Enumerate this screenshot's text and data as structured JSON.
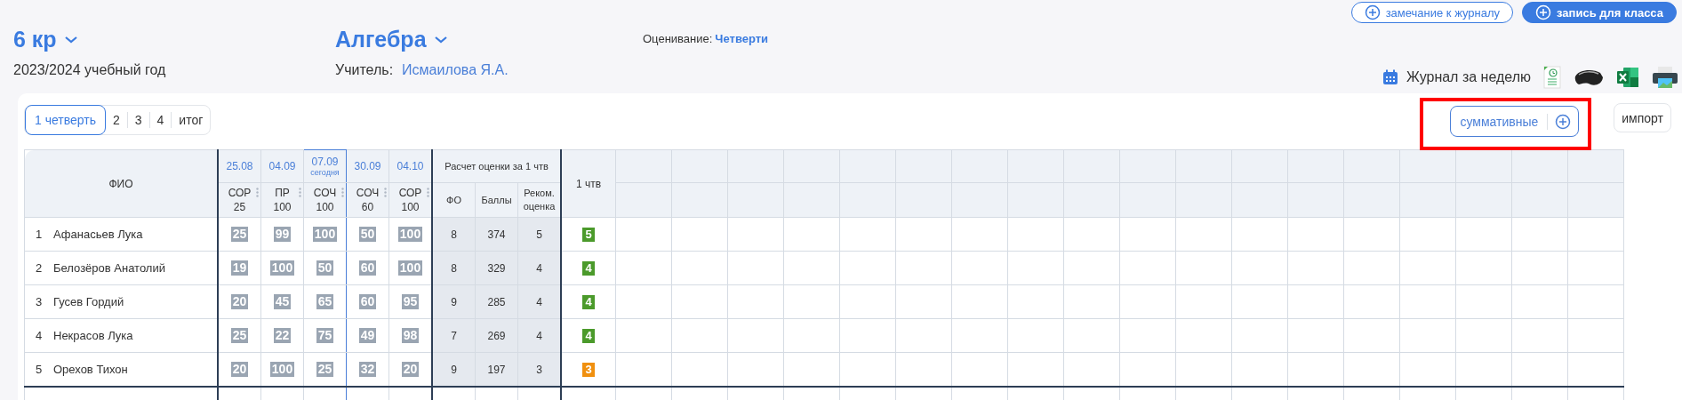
{
  "header_buttons": [
    {
      "label": "замечание к журналу",
      "kind": "outline"
    },
    {
      "label": "запись для класса",
      "kind": "filled"
    }
  ],
  "class_selector": {
    "label": "6 кр"
  },
  "school_year": "2023/2024 учебный год",
  "subject_selector": {
    "label": "Алгебра"
  },
  "teacher": {
    "label": "Учитель:",
    "value": "Исмаилова Я.А."
  },
  "grading": {
    "label": "Оценивание:",
    "value": "Четверти"
  },
  "toolbar": {
    "weekly_journal": "Журнал за неделю"
  },
  "period_tabs": [
    {
      "label": "1 четверть",
      "selected": true
    },
    {
      "label": "2",
      "selected": false
    },
    {
      "label": "3",
      "selected": false
    },
    {
      "label": "4",
      "selected": false
    },
    {
      "label": "итог",
      "selected": false
    }
  ],
  "summative_button": {
    "label": "суммативные",
    "highlighted": true
  },
  "import_button": {
    "label": "импорт"
  },
  "table": {
    "name_header": "ФИО",
    "assessments": [
      {
        "date": "25.08",
        "type": "СОР",
        "max": "25",
        "today": false
      },
      {
        "date": "04.09",
        "type": "ПР",
        "max": "100",
        "today": false
      },
      {
        "date": "07.09",
        "today_label": "сегодня",
        "type": "СОЧ",
        "max": "100",
        "today": true
      },
      {
        "date": "30.09",
        "type": "СОЧ",
        "max": "60",
        "today": false
      },
      {
        "date": "04.10",
        "type": "СОР",
        "max": "100",
        "today": false
      }
    ],
    "calc_header": "Расчет оценки за 1 чтв",
    "calc_columns": [
      "ФО",
      "Баллы",
      "Реком. оценка"
    ],
    "final_header": "1 чтв",
    "rows": [
      {
        "number": "1",
        "name": "Афанасьев Лука",
        "scores": [
          "25",
          "99",
          "100",
          "50",
          "100"
        ],
        "fo": "8",
        "points": "374",
        "recommended": "5",
        "final": {
          "value": "5",
          "color": "#4b9a2b"
        }
      },
      {
        "number": "2",
        "name": "Белозёров Анатолий",
        "scores": [
          "19",
          "100",
          "50",
          "60",
          "100"
        ],
        "fo": "8",
        "points": "329",
        "recommended": "4",
        "final": {
          "value": "4",
          "color": "#4b9a2b"
        }
      },
      {
        "number": "3",
        "name": "Гусев Гордий",
        "scores": [
          "20",
          "45",
          "65",
          "60",
          "95"
        ],
        "fo": "9",
        "points": "285",
        "recommended": "4",
        "final": {
          "value": "4",
          "color": "#4b9a2b"
        }
      },
      {
        "number": "4",
        "name": "Некрасов Лука",
        "scores": [
          "25",
          "22",
          "75",
          "49",
          "98"
        ],
        "fo": "7",
        "points": "269",
        "recommended": "4",
        "final": {
          "value": "4",
          "color": "#4b9a2b"
        }
      },
      {
        "number": "5",
        "name": "Орехов Тихон",
        "scores": [
          "20",
          "100",
          "25",
          "32",
          "20"
        ],
        "fo": "9",
        "points": "197",
        "recommended": "3",
        "final": {
          "value": "3",
          "color": "#f0900f"
        }
      }
    ]
  }
}
